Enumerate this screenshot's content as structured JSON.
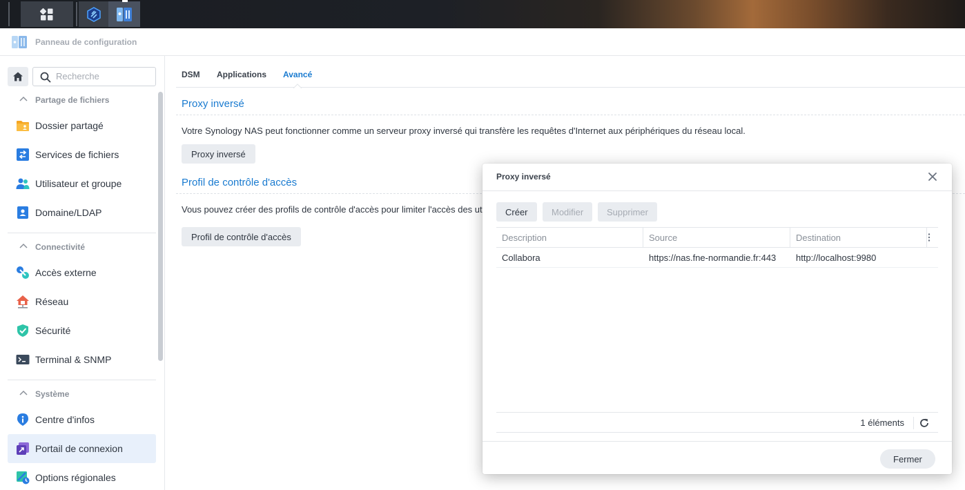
{
  "window": {
    "title": "Panneau de configuration"
  },
  "search": {
    "placeholder": "Recherche"
  },
  "sidebar": {
    "sections": [
      {
        "label": "Partage de fichiers",
        "items": [
          "Dossier partagé",
          "Services de fichiers",
          "Utilisateur et groupe",
          "Domaine/LDAP"
        ]
      },
      {
        "label": "Connectivité",
        "items": [
          "Accès externe",
          "Réseau",
          "Sécurité",
          "Terminal & SNMP"
        ]
      },
      {
        "label": "Système",
        "items": [
          "Centre d'infos",
          "Portail de connexion",
          "Options régionales"
        ]
      }
    ],
    "selected": "Portail de connexion"
  },
  "tabs": [
    {
      "label": "DSM",
      "active": false
    },
    {
      "label": "Applications",
      "active": false
    },
    {
      "label": "Avancé",
      "active": true
    }
  ],
  "content": {
    "sections": [
      {
        "title": "Proxy inversé",
        "description": "Votre Synology NAS peut fonctionner comme un serveur proxy inversé qui transfère les requêtes d'Internet aux périphériques du réseau local.",
        "button": "Proxy inversé"
      },
      {
        "title": "Profil de contrôle d'accès",
        "description": "Vous pouvez créer des profils de contrôle d'accès pour limiter l'accès des ut",
        "button": "Profil de contrôle d'accès"
      }
    ]
  },
  "dialog": {
    "title": "Proxy inversé",
    "buttons": {
      "create": "Créer",
      "edit": "Modifier",
      "delete": "Supprimer"
    },
    "columns": [
      "Description",
      "Source",
      "Destination"
    ],
    "rows": [
      {
        "description": "Collabora",
        "source": "https://nas.fne-normandie.fr:443",
        "destination": "http://localhost:9980"
      }
    ],
    "count_label": "1 éléments",
    "close_label": "Fermer"
  },
  "colors": {
    "accent": "#1a7bd0",
    "button_bg": "#e9ecf0",
    "selected_bg": "#e8f0fb"
  },
  "icons": {
    "taskbar": [
      "main-menu-icon",
      "synology-app-icon",
      "control-panel-icon"
    ],
    "sidebar": [
      "folder-share-icon",
      "file-services-icon",
      "user-group-icon",
      "domain-ldap-icon",
      "external-access-icon",
      "network-icon",
      "security-shield-icon",
      "terminal-icon",
      "info-center-icon",
      "login-portal-icon",
      "regional-options-icon"
    ]
  }
}
